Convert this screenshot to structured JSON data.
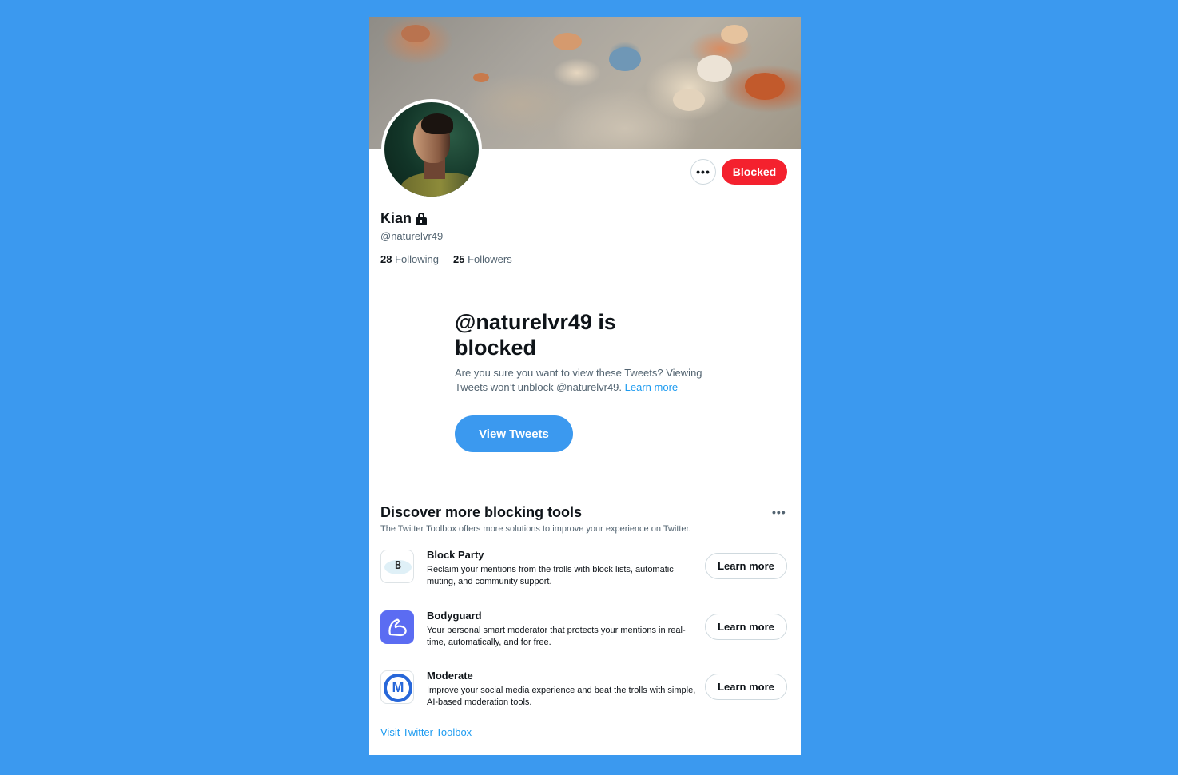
{
  "profile": {
    "name": "Kian",
    "handle": "@naturelvr49",
    "following_count": "28",
    "following_label": "Following",
    "followers_count": "25",
    "followers_label": "Followers",
    "blocked_button": "Blocked",
    "more_button": "•••"
  },
  "blocked_notice": {
    "title": "@naturelvr49 is blocked",
    "description": "Are you sure you want to view these Tweets? Viewing Tweets won’t unblock @naturelvr49.",
    "learn_more": "Learn more",
    "view_button": "View Tweets"
  },
  "tools": {
    "title": "Discover more blocking tools",
    "subtitle": "The Twitter Toolbox offers more solutions to improve your experience on Twitter.",
    "more_button": "•••",
    "items": [
      {
        "name": "Block Party",
        "description": "Reclaim your mentions from the trolls with block lists, automatic muting, and community support.",
        "button": "Learn more",
        "icon_letter": "B"
      },
      {
        "name": "Bodyguard",
        "description": "Your personal smart moderator that protects your mentions in real-time, automatically, and for free.",
        "button": "Learn more"
      },
      {
        "name": "Moderate",
        "description": "Improve your social media experience and beat the trolls with simple, AI-based moderation tools.",
        "button": "Learn more",
        "icon_letter": "M"
      }
    ],
    "footer_link": "Visit Twitter Toolbox"
  },
  "colors": {
    "background": "#3b99ef",
    "blocked_red": "#f4212e",
    "link_blue": "#1d9bf0",
    "bodyguard_purple": "#5b6cf2",
    "moderate_blue": "#2767d9"
  }
}
